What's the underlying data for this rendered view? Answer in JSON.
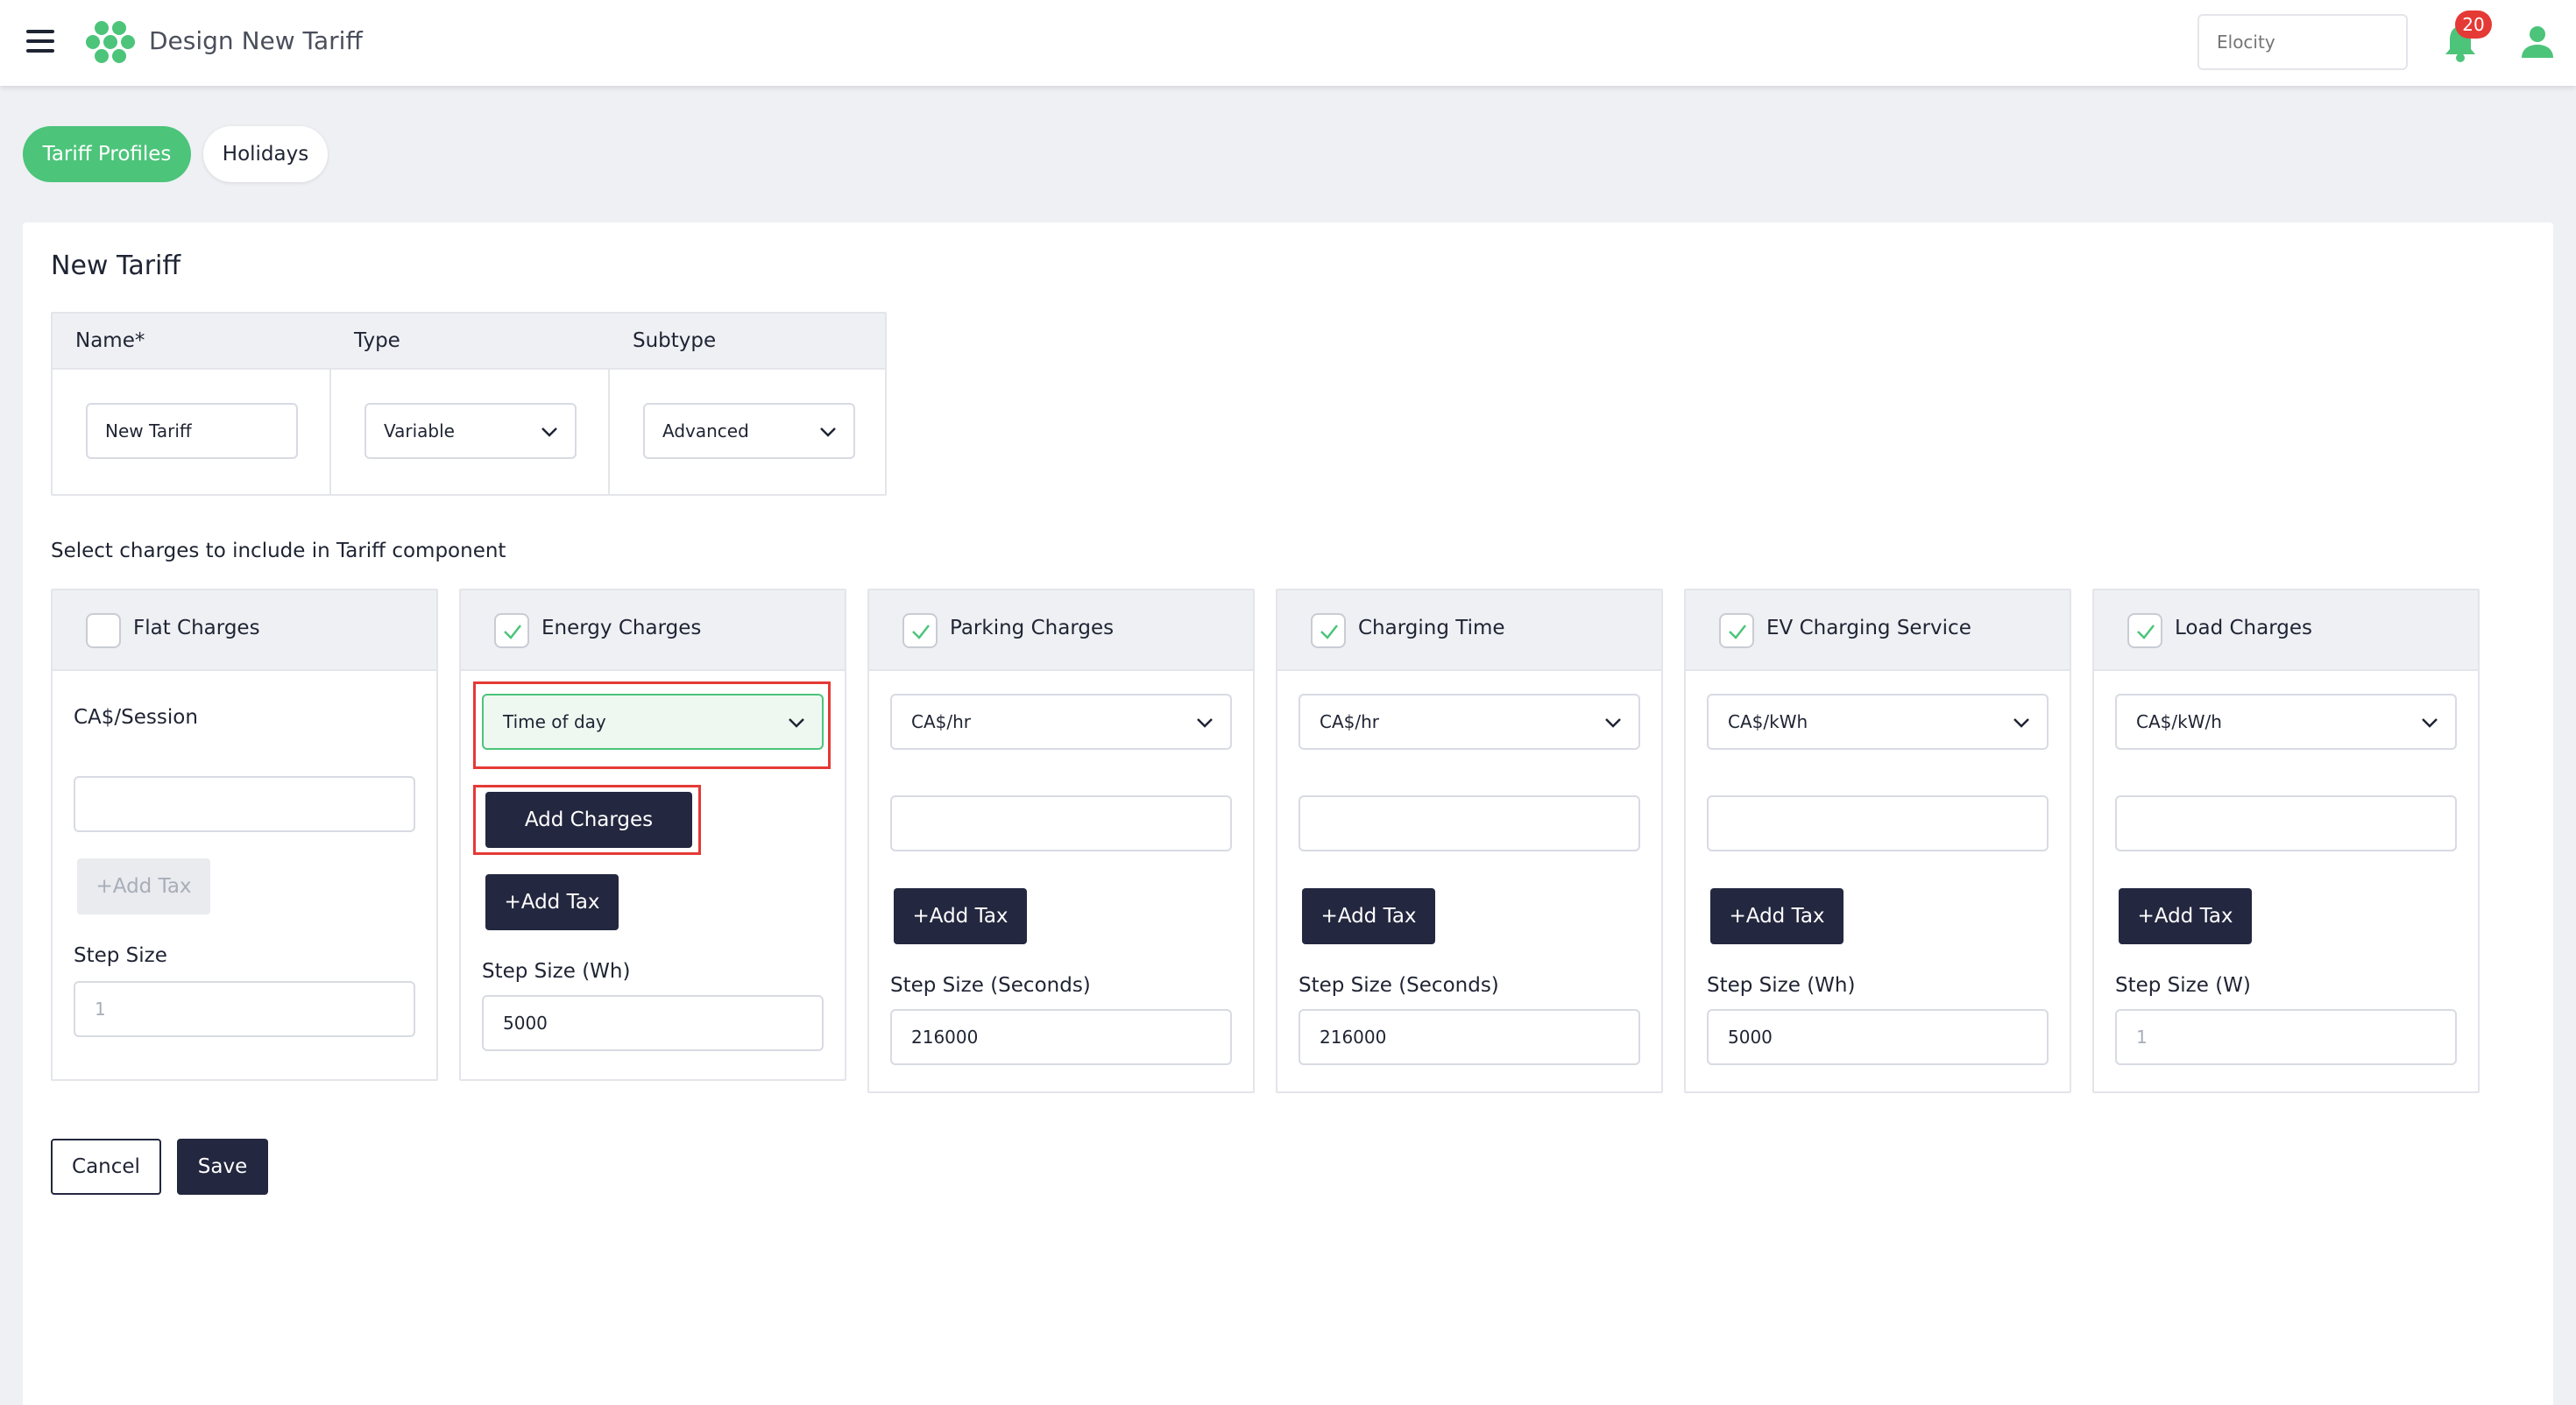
{
  "header": {
    "menu_icon": "hamburger-menu-icon",
    "logo_icon": "hexagon-cluster-logo",
    "title": "Design New Tariff",
    "search_placeholder": "Elocity",
    "notification_count": "20",
    "accent": "#4cc47a"
  },
  "tabs": [
    {
      "label": "Tariff Profiles",
      "active": true
    },
    {
      "label": "Holidays",
      "active": false
    }
  ],
  "form": {
    "title": "New Tariff",
    "columns": {
      "name": "Name*",
      "type": "Type",
      "subtype": "Subtype"
    },
    "values": {
      "name": "New Tariff",
      "type": "Variable",
      "subtype": "Advanced"
    },
    "section_label": "Select charges to include in Tariff component"
  },
  "charges": {
    "flat": {
      "title": "Flat Charges",
      "checked": false,
      "unit_label": "CA$/Session",
      "value": "",
      "add_tax": "+Add Tax",
      "step_label": "Step Size",
      "step_value": "1"
    },
    "energy": {
      "title": "Energy Charges",
      "checked": true,
      "unit": "Time of day",
      "add_charges": "Add Charges",
      "add_tax": "+Add Tax",
      "step_label": "Step Size (Wh)",
      "step_value": "5000"
    },
    "parking": {
      "title": "Parking Charges",
      "checked": true,
      "unit": "CA$/hr",
      "value": "",
      "add_tax": "+Add Tax",
      "step_label": "Step Size (Seconds)",
      "step_value": "216000"
    },
    "charging_time": {
      "title": "Charging Time",
      "checked": true,
      "unit": "CA$/hr",
      "value": "",
      "add_tax": "+Add Tax",
      "step_label": "Step Size (Seconds)",
      "step_value": "216000"
    },
    "ev_service": {
      "title": "EV Charging Service",
      "checked": true,
      "unit": "CA$/kWh",
      "value": "",
      "add_tax": "+Add Tax",
      "step_label": "Step Size (Wh)",
      "step_value": "5000"
    },
    "load": {
      "title": "Load Charges",
      "checked": true,
      "unit": "CA$/kW/h",
      "value": "",
      "add_tax": "+Add Tax",
      "step_label": "Step Size (W)",
      "step_value": "1"
    }
  },
  "footer": {
    "cancel": "Cancel",
    "save": "Save"
  }
}
